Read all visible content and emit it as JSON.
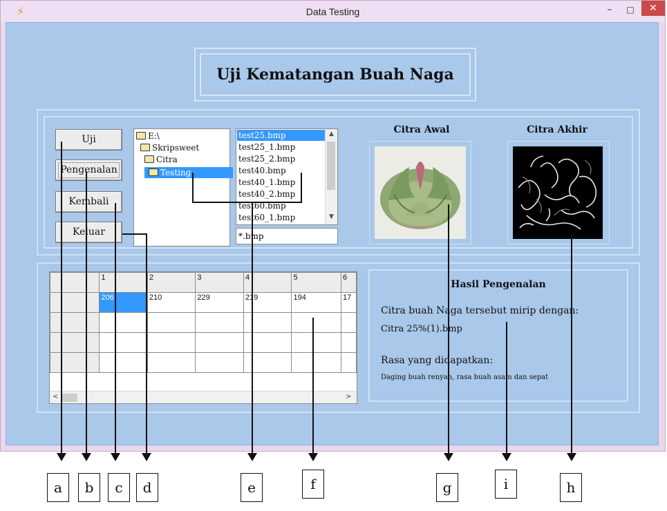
{
  "window": {
    "title": "Data Testing",
    "minimize_glyph": "–",
    "maximize_glyph": "□",
    "close_glyph": "✕",
    "app_icon_glyph": "⚡"
  },
  "header": {
    "title": "Uji Kematangan Buah Naga"
  },
  "buttons": {
    "uji": "Uji",
    "pengenalan": "Pengenalan",
    "kembali": "Kembali",
    "keluar": "Keluar"
  },
  "directory": {
    "items": [
      {
        "label": "E:\\"
      },
      {
        "label": "Skripsweet"
      },
      {
        "label": "Citra"
      },
      {
        "label": "Testing"
      }
    ],
    "selected": "Testing"
  },
  "files": {
    "items": [
      "test25.bmp",
      "test25_1.bmp",
      "test25_2.bmp",
      "test40.bmp",
      "test40_1.bmp",
      "test40_2.bmp",
      "test60.bmp",
      "test60_1.bmp"
    ],
    "selected": "test25.bmp",
    "filter": "*.bmp"
  },
  "images": {
    "awal_label": "Citra Awal",
    "akhir_label": "Citra Akhir"
  },
  "grid": {
    "headers": [
      "",
      "1",
      "2",
      "3",
      "4",
      "5",
      "6"
    ],
    "row1": [
      "",
      "206",
      "210",
      "229",
      "219",
      "194",
      "17"
    ]
  },
  "result": {
    "title": "Hasil Pengenalan",
    "line1": "Citra buah Naga tersebut mirip dengan:",
    "line2": "Citra 25%(1).bmp",
    "line3": "Rasa yang didapatkan:",
    "line4": "Daging buah renyah, rasa buah asam dan sepat"
  },
  "annotations": [
    "a",
    "b",
    "c",
    "d",
    "e",
    "f",
    "g",
    "i",
    "h"
  ],
  "colors": {
    "client_bg": "#a9c8ea",
    "selection": "#3399ff",
    "close_button": "#c94a4a",
    "titlebar": "#efdff2"
  }
}
